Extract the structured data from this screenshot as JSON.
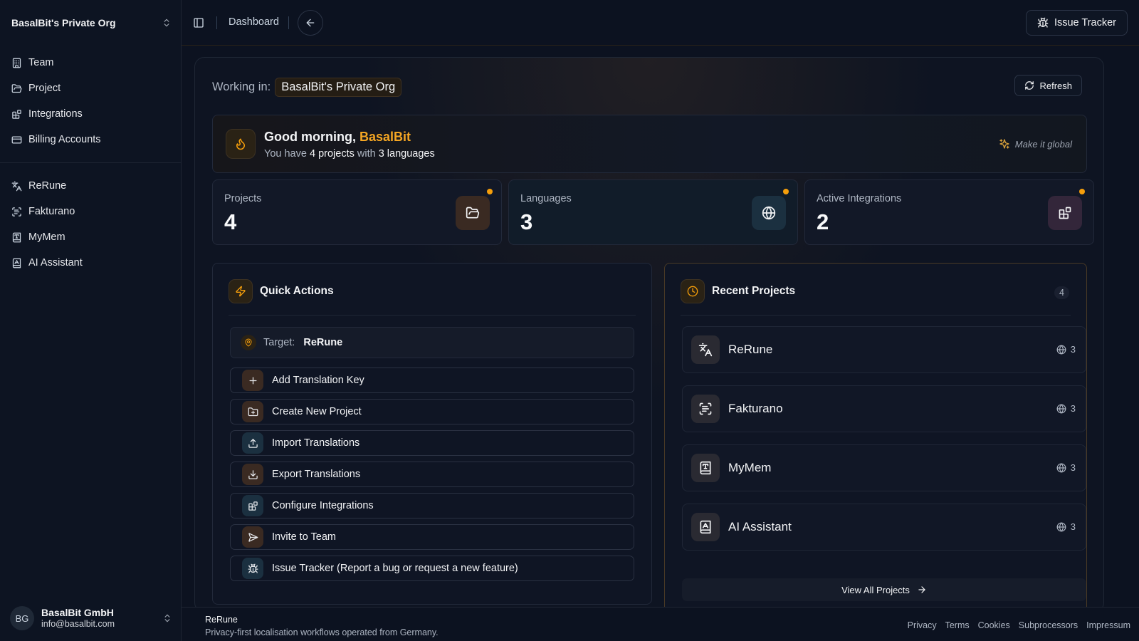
{
  "sidebar": {
    "org_name": "BasalBit's Private Org",
    "nav": [
      {
        "label": "Team",
        "icon": "building-icon"
      },
      {
        "label": "Project",
        "icon": "folder-open-icon"
      },
      {
        "label": "Integrations",
        "icon": "blocks-icon"
      },
      {
        "label": "Billing Accounts",
        "icon": "credit-card-icon"
      }
    ],
    "projects": [
      {
        "label": "ReRune",
        "icon": "languages-icon"
      },
      {
        "label": "Fakturano",
        "icon": "scan-text-icon"
      },
      {
        "label": "MyMem",
        "icon": "book-type-icon"
      },
      {
        "label": "AI Assistant",
        "icon": "book-a-icon"
      }
    ],
    "user": {
      "initials": "BG",
      "name": "BasalBit GmbH",
      "email": "info@basalbit.com"
    }
  },
  "topbar": {
    "breadcrumb": "Dashboard",
    "issue_tracker_label": "Issue Tracker"
  },
  "main": {
    "working_in_label": "Working in:",
    "working_in_org": "BasalBit's Private Org",
    "refresh_label": "Refresh",
    "greeting": {
      "prefix": "Good morning,",
      "name": "BasalBit",
      "sub_prefix": "You have",
      "projects_text": "4 projects",
      "sub_mid": "with",
      "languages_text": "3 languages",
      "make_global": "Make it global"
    },
    "stats": [
      {
        "label": "Projects",
        "value": "4",
        "icon": "folder-open-icon"
      },
      {
        "label": "Languages",
        "value": "3",
        "icon": "globe-icon"
      },
      {
        "label": "Active Integrations",
        "value": "2",
        "icon": "blocks-icon"
      }
    ],
    "quick_actions": {
      "title": "Quick Actions",
      "target_label": "Target:",
      "target_value": "ReRune",
      "actions": [
        {
          "label": "Add Translation Key",
          "icon": "plus-icon"
        },
        {
          "label": "Create New Project",
          "icon": "folder-plus-icon"
        },
        {
          "label": "Import Translations",
          "icon": "upload-icon"
        },
        {
          "label": "Export Translations",
          "icon": "download-icon"
        },
        {
          "label": "Configure Integrations",
          "icon": "blocks-icon"
        },
        {
          "label": "Invite to Team",
          "icon": "send-icon"
        },
        {
          "label": "Issue Tracker (Report a bug or request a new feature)",
          "icon": "bug-icon"
        }
      ]
    },
    "recent_projects": {
      "title": "Recent Projects",
      "count": "4",
      "items": [
        {
          "name": "ReRune",
          "languages": "3",
          "icon": "languages-icon"
        },
        {
          "name": "Fakturano",
          "languages": "3",
          "icon": "scan-text-icon"
        },
        {
          "name": "MyMem",
          "languages": "3",
          "icon": "book-type-icon"
        },
        {
          "name": "AI Assistant",
          "languages": "3",
          "icon": "book-a-icon"
        }
      ],
      "view_all_label": "View All Projects"
    }
  },
  "footer": {
    "brand": "ReRune",
    "tagline": "Privacy-first localisation workflows operated from Germany.",
    "links": [
      "Privacy",
      "Terms",
      "Cookies",
      "Subprocessors",
      "Impressum"
    ]
  },
  "colors": {
    "accent": "#f5a623",
    "background": "#0c1220",
    "status_dot": "#f59e0b"
  }
}
